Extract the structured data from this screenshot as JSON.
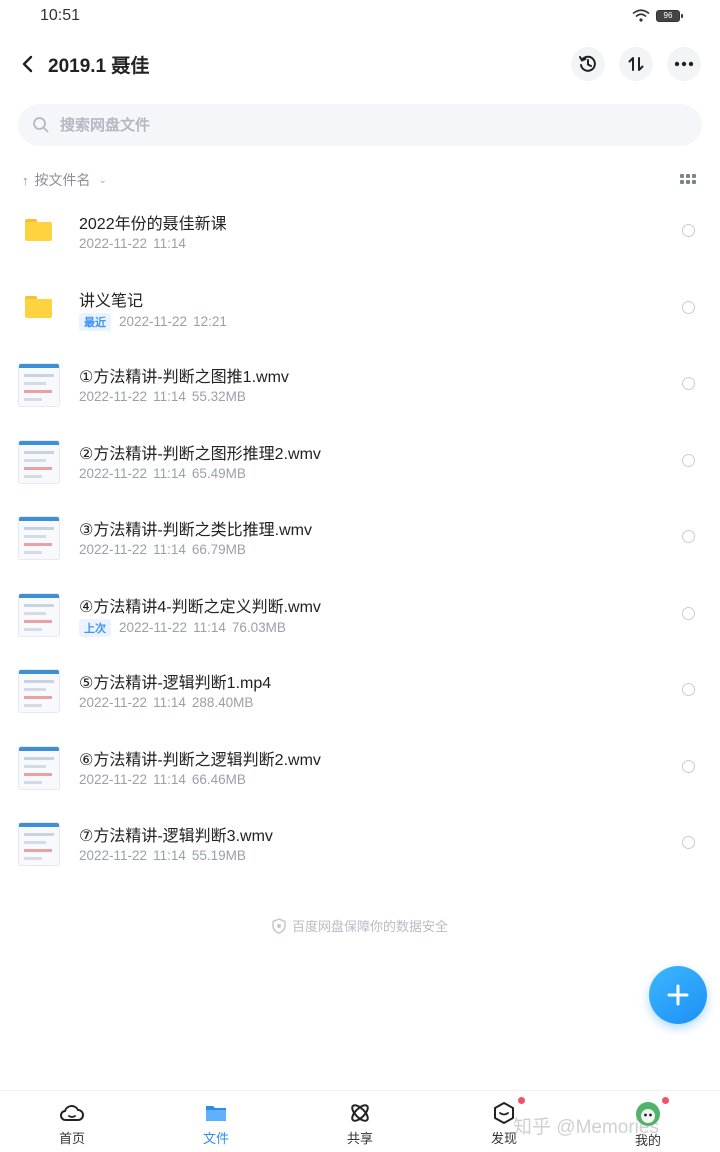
{
  "status": {
    "time": "10:51",
    "battery": "96"
  },
  "header": {
    "title": "2019.1 聂佳"
  },
  "search": {
    "placeholder": "搜索网盘文件"
  },
  "sort": {
    "label": "按文件名"
  },
  "files": [
    {
      "name": "2022年份的聂佳新课",
      "type": "folder",
      "tag": "",
      "date": "2022-11-22",
      "time": "11:14",
      "size": ""
    },
    {
      "name": "讲义笔记",
      "type": "folder",
      "tag": "最近",
      "date": "2022-11-22",
      "time": "12:21",
      "size": ""
    },
    {
      "name": "①方法精讲-判断之图推1.wmv",
      "type": "video",
      "tag": "",
      "date": "2022-11-22",
      "time": "11:14",
      "size": "55.32MB"
    },
    {
      "name": "②方法精讲-判断之图形推理2.wmv",
      "type": "video",
      "tag": "",
      "date": "2022-11-22",
      "time": "11:14",
      "size": "65.49MB"
    },
    {
      "name": "③方法精讲-判断之类比推理.wmv",
      "type": "video",
      "tag": "",
      "date": "2022-11-22",
      "time": "11:14",
      "size": "66.79MB"
    },
    {
      "name": "④方法精讲4-判断之定义判断.wmv",
      "type": "video",
      "tag": "上次",
      "date": "2022-11-22",
      "time": "11:14",
      "size": "76.03MB"
    },
    {
      "name": "⑤方法精讲-逻辑判断1.mp4",
      "type": "video",
      "tag": "",
      "date": "2022-11-22",
      "time": "11:14",
      "size": "288.40MB"
    },
    {
      "name": "⑥方法精讲-判断之逻辑判断2.wmv",
      "type": "video",
      "tag": "",
      "date": "2022-11-22",
      "time": "11:14",
      "size": "66.46MB"
    },
    {
      "name": "⑦方法精讲-逻辑判断3.wmv",
      "type": "video",
      "tag": "",
      "date": "2022-11-22",
      "time": "11:14",
      "size": "55.19MB"
    }
  ],
  "security_note": "百度网盘保障你的数据安全",
  "tabs": [
    {
      "label": "首页",
      "icon": "cloud-icon",
      "active": false
    },
    {
      "label": "文件",
      "icon": "folder-icon",
      "active": true
    },
    {
      "label": "共享",
      "icon": "share-icon",
      "active": false
    },
    {
      "label": "发现",
      "icon": "discover-icon",
      "active": false
    },
    {
      "label": "我的",
      "icon": "avatar-icon",
      "active": false
    }
  ],
  "watermark": "知乎 @Memories",
  "colors": {
    "accent": "#2d8cf0",
    "fab": "#1d8ff5",
    "folder": "#ffd23f",
    "badge_dot": "#f0506e"
  }
}
